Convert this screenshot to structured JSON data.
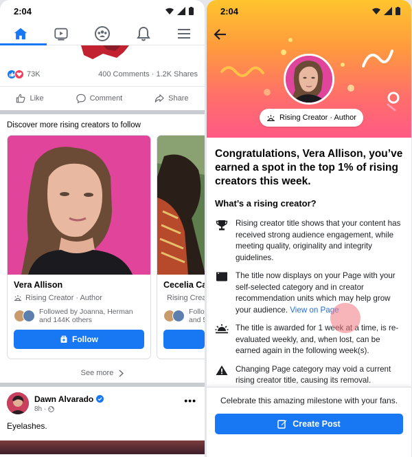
{
  "left": {
    "time": "2:04",
    "nav": [
      "home-icon",
      "watch-icon",
      "groups-icon",
      "notifications-icon",
      "menu-icon"
    ],
    "post_stats": {
      "reactions": "73K",
      "comments_shares": "400 Comments · 1.2K Shares"
    },
    "actions": {
      "like": "Like",
      "comment": "Comment",
      "share": "Share"
    },
    "discover": {
      "title": "Discover more rising creators to follow",
      "cards": [
        {
          "name": "Vera Allison",
          "subtitle": "Rising Creator · Author",
          "followed_line1": "Followed by Joanna, Herman",
          "followed_line2": "and 144K others",
          "button": "Follow"
        },
        {
          "name": "Cecelia Car",
          "subtitle": "Rising Crea",
          "followed_line1": "Follo",
          "followed_line2": "and 5"
        }
      ],
      "see_more": "See more"
    },
    "next_post": {
      "author": "Dawn Alvarado",
      "meta": "8h ·",
      "text": "Eyelashes."
    }
  },
  "right": {
    "time": "2:04",
    "badge": "Rising Creator · Author",
    "congrats": "Congratulations, Vera Allison, you’ve earned a spot in the top 1% of rising creators this week.",
    "subhead": "What’s a rising creator?",
    "items": [
      {
        "icon": "trophy-icon",
        "text": "Rising creator title shows that your content has received strong audience engagement, while meeting quality, originality and integrity guidelines."
      },
      {
        "icon": "page-icon",
        "text": "The title now displays on your Page with your self-selected category and in creator recommendation units which may help grow your audience. ",
        "link": "View on Page"
      },
      {
        "icon": "sunrise-icon",
        "text": "The title is awarded for 1 week at a time, is re-evaluated weekly, and, when lost, can be earned again in the following week(s)."
      },
      {
        "icon": "warning-icon",
        "text": "Changing Page category may void a current rising creator title, causing its removal."
      }
    ],
    "footer_text": "Celebrate this amazing milestone with your fans.",
    "create_post": "Create Post"
  },
  "colors": {
    "brand": "#1877f2",
    "hero_top": "#ffc52e",
    "hero_bottom": "#ff5a84"
  }
}
